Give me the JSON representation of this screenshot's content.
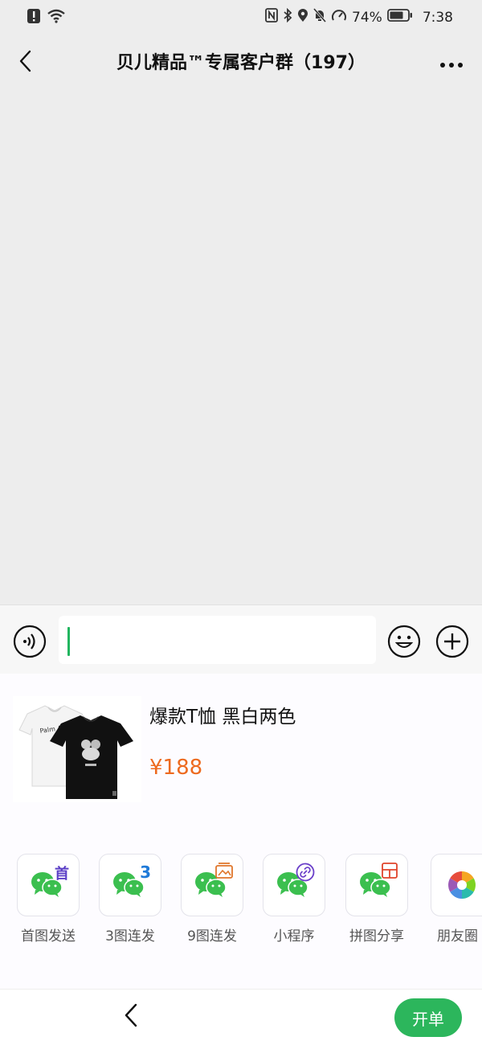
{
  "status_bar": {
    "battery_percent": "74%",
    "time": "7:38",
    "icons": [
      "alert-icon",
      "wifi-icon",
      "nfc-icon",
      "bluetooth-icon",
      "location-icon",
      "mute-bell-icon",
      "speed-icon",
      "battery-icon"
    ]
  },
  "header": {
    "title": "贝儿精品™专属客户群（197）",
    "back_icon": "chevron-left-icon",
    "more_icon": "more-dots-icon"
  },
  "input_bar": {
    "value": "",
    "voice_icon": "voice-icon",
    "emoji_icon": "emoji-icon",
    "plus_icon": "plus-icon",
    "caret_color": "#21b55f"
  },
  "product": {
    "name": "爆款T恤 黑白两色",
    "price": "¥188",
    "price_color": "#ed6a1f"
  },
  "tools": [
    {
      "label": "首图发送",
      "icon": "wechat-icon",
      "mark": "首"
    },
    {
      "label": "3图连发",
      "icon": "wechat-icon",
      "mark": "3"
    },
    {
      "label": "9图连发",
      "icon": "wechat-icon",
      "mark": "images-icon"
    },
    {
      "label": "小程序",
      "icon": "wechat-icon",
      "mark": "link-icon"
    },
    {
      "label": "拼图分享",
      "icon": "wechat-icon",
      "mark": "collage-icon"
    },
    {
      "label": "朋友圈",
      "icon": "moments-aperture-icon"
    }
  ],
  "bottom_bar": {
    "back_icon": "chevron-left-icon",
    "order_label": "开单",
    "order_color": "#2cb65c"
  }
}
